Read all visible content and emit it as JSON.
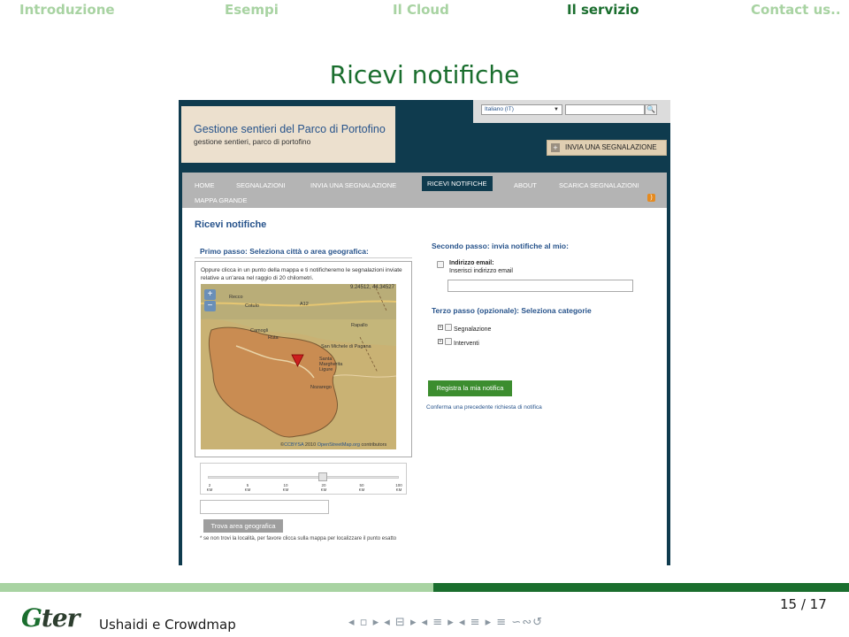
{
  "slide": {
    "nav": [
      "Introduzione",
      "Esempi",
      "Il Cloud",
      "Il servizio",
      "Contact us.."
    ],
    "active_nav": "Il servizio",
    "title": "Ricevi notifiche",
    "footer_title": "Ushaidi e Crowdmap",
    "page": "15 / 17",
    "logo": {
      "g": "G",
      "rest": "ter"
    },
    "nav_symbols": "◂ ▫ ▸ ◂ ⊟ ▸ ◂ ≡ ▸ ◂ ≡ ▸   ≡   ∽∾↺",
    "colors": {
      "accent": "#1a6e2e",
      "nav_inactive": "#a8d3a2"
    }
  },
  "site": {
    "title": "Gestione sentieri del Parco di Portofino",
    "subtitle": "gestione sentieri, parco di portofino",
    "language": "Italiano (IT)",
    "search_placeholder": "",
    "search_icon": "search-icon",
    "invia_button": "INVIA UNA SEGNALAZIONE",
    "menu": [
      "HOME",
      "SEGNALAZIONI",
      "INVIA UNA SEGNALAZIONE",
      "RICEVI NOTIFICHE",
      "ABOUT",
      "SCARICA SEGNALAZIONI",
      "MAPPA GRANDE"
    ],
    "active_menu": "RICEVI NOTIFICHE",
    "rss_icon": "rss-icon"
  },
  "page": {
    "title": "Ricevi notifiche",
    "step1": "Primo passo: Seleziona città o area geografica:",
    "map_description": "Oppure clicca in un punto della mappa e ti notificheremo le segnalazioni inviate relative a un'area nel raggio di 20 chilometri.",
    "coords": "9.24512, 44.34527",
    "map_labels": [
      "Recco",
      "Cotulo",
      "Camogli",
      "Ruta",
      "Rapallo",
      "San Michele di Pagana",
      "Santa Margherita Ligure",
      "Nozarego",
      "A12"
    ],
    "attribution_prefix": "©",
    "attribution_ccbysa": "CCBYSA",
    "attribution_year": " 2010 ",
    "attribution_osm": "OpenStreetMap.org",
    "attribution_suffix": " contributors",
    "radius_ticks": [
      {
        "value": "2",
        "unit": "KM"
      },
      {
        "value": "5",
        "unit": "KM"
      },
      {
        "value": "10",
        "unit": "KM"
      },
      {
        "value": "20",
        "unit": "KM"
      },
      {
        "value": "50",
        "unit": "KM"
      },
      {
        "value": "100",
        "unit": "KM"
      }
    ],
    "selected_radius_km": 20,
    "location_input": "",
    "trova_button": "Trova area geografica",
    "note": "* se non trovi la località, per favore clicca sulla mappa per localizzare il punto esatto",
    "step2": "Secondo passo: invia notifiche al mio:",
    "email_label": "Indirizzo email:",
    "email_hint": "Inserisci indirizzo email",
    "email_value": "",
    "step3": "Terzo passo (opzionale): Seleziona categorie",
    "categories": [
      "Segnalazione",
      "Interventi"
    ],
    "register_button": "Registra la mia notifica",
    "confirm_link": "Conferma una precedente richiesta di notifica"
  }
}
